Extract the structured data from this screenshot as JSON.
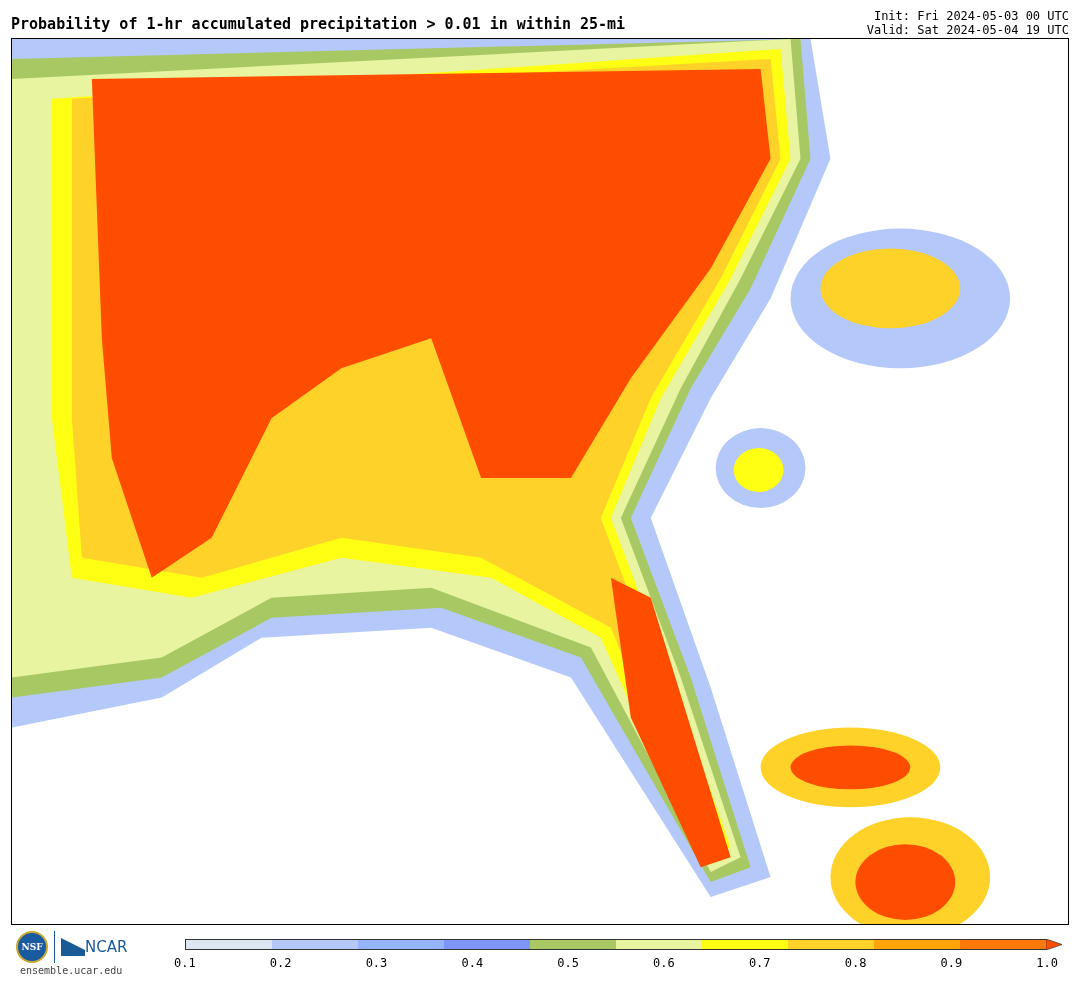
{
  "title": "Probability of 1-hr accumulated precipitation > 0.01 in within 25-mi",
  "init": "Init: Fri 2024-05-03 00 UTC",
  "valid": "Valid: Sat 2024-05-04 19 UTC",
  "logos": {
    "nsf": "NSF",
    "ncar": "NCAR",
    "site": "ensemble.ucar.edu"
  },
  "colorbar": {
    "segments": [
      {
        "color": "#dce6f2"
      },
      {
        "color": "#b4c8fa"
      },
      {
        "color": "#96b4fa"
      },
      {
        "color": "#7d96f5"
      },
      {
        "color": "#a8c864"
      },
      {
        "color": "#e8f4a0"
      },
      {
        "color": "#ffff14"
      },
      {
        "color": "#ffd22a"
      },
      {
        "color": "#ffa50a"
      },
      {
        "color": "#ff780a"
      }
    ],
    "ticks": [
      "0.1",
      "0.2",
      "0.3",
      "0.4",
      "0.5",
      "0.6",
      "0.7",
      "0.8",
      "0.9",
      "1.0"
    ]
  }
}
